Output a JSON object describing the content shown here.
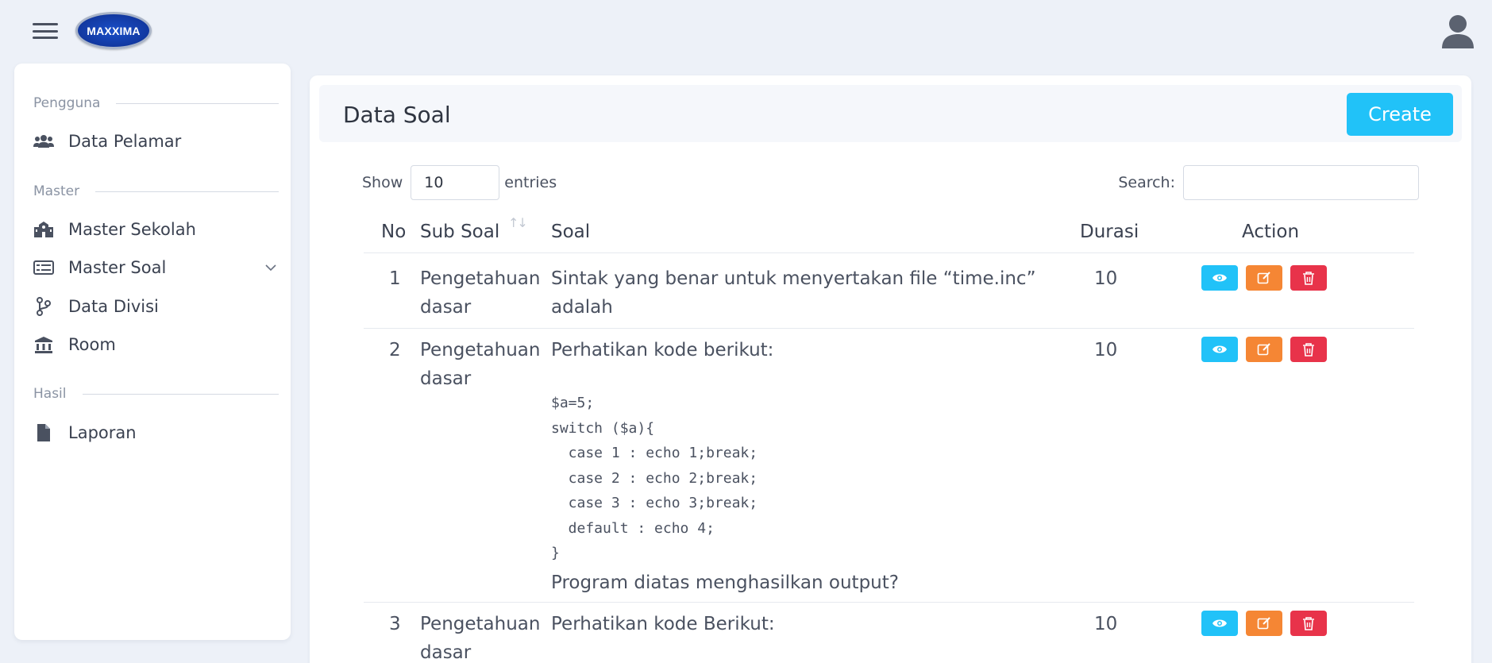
{
  "header": {
    "logo_text": "MAXXIMA"
  },
  "sidebar": {
    "sections": [
      {
        "title": "Pengguna"
      },
      {
        "title": "Master"
      },
      {
        "title": "Hasil"
      }
    ],
    "items": [
      {
        "label": "Data Pelamar",
        "icon": "users-icon"
      },
      {
        "label": "Master Sekolah",
        "icon": "school-icon"
      },
      {
        "label": "Master Soal",
        "icon": "list-icon"
      },
      {
        "label": "Data Divisi",
        "icon": "branch-icon"
      },
      {
        "label": "Room",
        "icon": "bank-icon"
      },
      {
        "label": "Laporan",
        "icon": "file-icon"
      }
    ]
  },
  "main": {
    "title": "Data Soal",
    "create_label": "Create",
    "show_label": "Show",
    "entries_value": "10",
    "entries_label": "entries",
    "search_label": "Search:",
    "search_value": ""
  },
  "table": {
    "columns": [
      "No",
      "Sub Soal",
      "Soal",
      "Durasi",
      "Action"
    ],
    "rows": [
      {
        "no": "1",
        "sub_soal": "Pengetahuan dasar",
        "soal": "Sintak yang benar untuk menyertakan file “time.inc” adalah",
        "durasi": "10"
      },
      {
        "no": "2",
        "sub_soal": "Pengetahuan dasar",
        "soal": "Perhatikan kode berikut:",
        "code": "$a=5;\nswitch ($a){\n  case 1 : echo 1;break;\n  case 2 : echo 2;break;\n  case 3 : echo 3;break;\n  default : echo 4;\n}",
        "soal_after": "Program diatas menghasilkan output?",
        "durasi": "10"
      },
      {
        "no": "3",
        "sub_soal": "Pengetahuan dasar",
        "soal": "Perhatikan kode Berikut:",
        "durasi": "10"
      }
    ]
  },
  "colors": {
    "accent": "#21c2f8",
    "edit": "#f58634",
    "delete": "#e8334a",
    "background": "#edf1f8"
  }
}
